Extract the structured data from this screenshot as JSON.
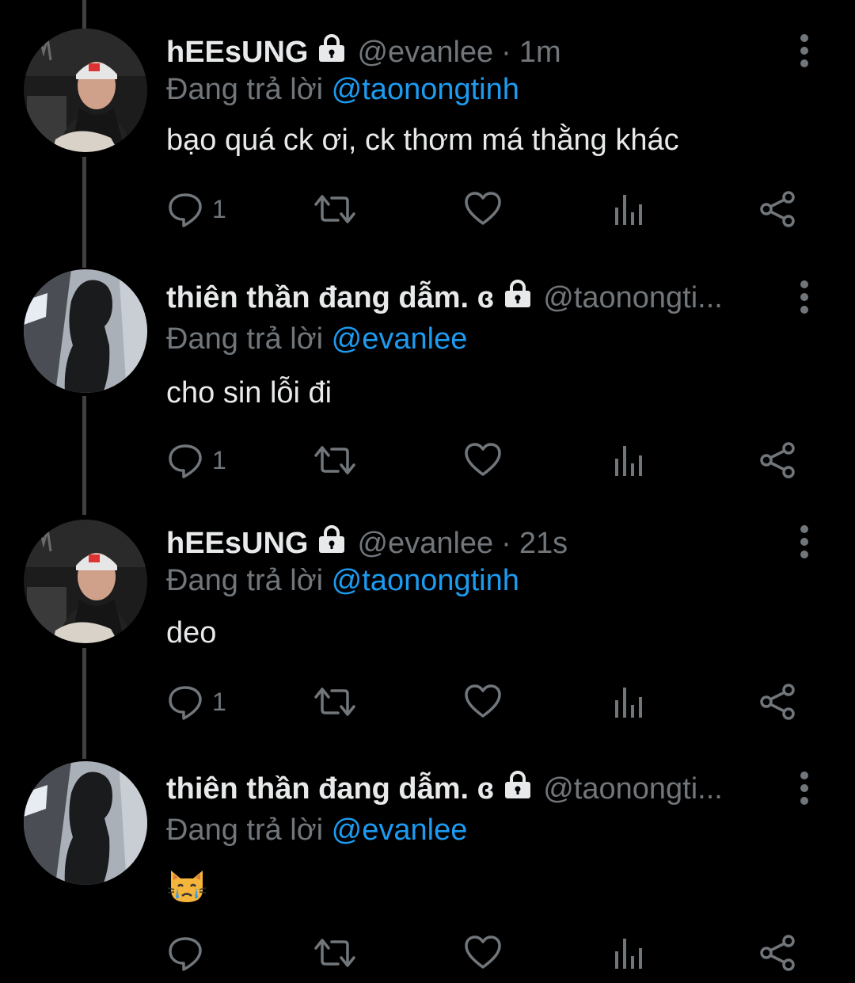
{
  "colors": {
    "background": "#000000",
    "text_primary": "#E7E9EA",
    "text_secondary": "#71767B",
    "mention": "#1D9BF0",
    "thread_line": "#3E4144"
  },
  "tweets": [
    {
      "name": "hEEsUNG",
      "handle": "@evanlee",
      "dot": "·",
      "time": "1m",
      "replying_prefix": "Đang trả lời",
      "mention": "@taonongtinh",
      "text": "bạo quá ck ơi, ck thơm má thằng khác",
      "reply_count": "1",
      "avatar_icon": "avatar-photo-person-cap",
      "lock_icon": "lock-icon"
    },
    {
      "name": "thiên thần đang dẫm. ɞ",
      "handle": "@taonongti...",
      "dot": "",
      "time": "",
      "replying_prefix": "Đang trả lời",
      "mention": "@evanlee",
      "text": "cho sin lỗi đi",
      "reply_count": "1",
      "avatar_icon": "avatar-photo-silhouette",
      "lock_icon": "lock-icon"
    },
    {
      "name": "hEEsUNG",
      "handle": "@evanlee",
      "dot": "·",
      "time": "21s",
      "replying_prefix": "Đang trả lời",
      "mention": "@taonongtinh",
      "text": "deo",
      "reply_count": "1",
      "avatar_icon": "avatar-photo-person-cap",
      "lock_icon": "lock-icon"
    },
    {
      "name": "thiên thần đang dẫm. ɞ",
      "handle": "@taonongti...",
      "dot": "",
      "time": "",
      "replying_prefix": "Đang trả lời",
      "mention": "@evanlee",
      "text": "",
      "text_emoji": "crying-cat-emoji",
      "reply_count": "",
      "avatar_icon": "avatar-photo-silhouette",
      "lock_icon": "lock-icon"
    }
  ]
}
